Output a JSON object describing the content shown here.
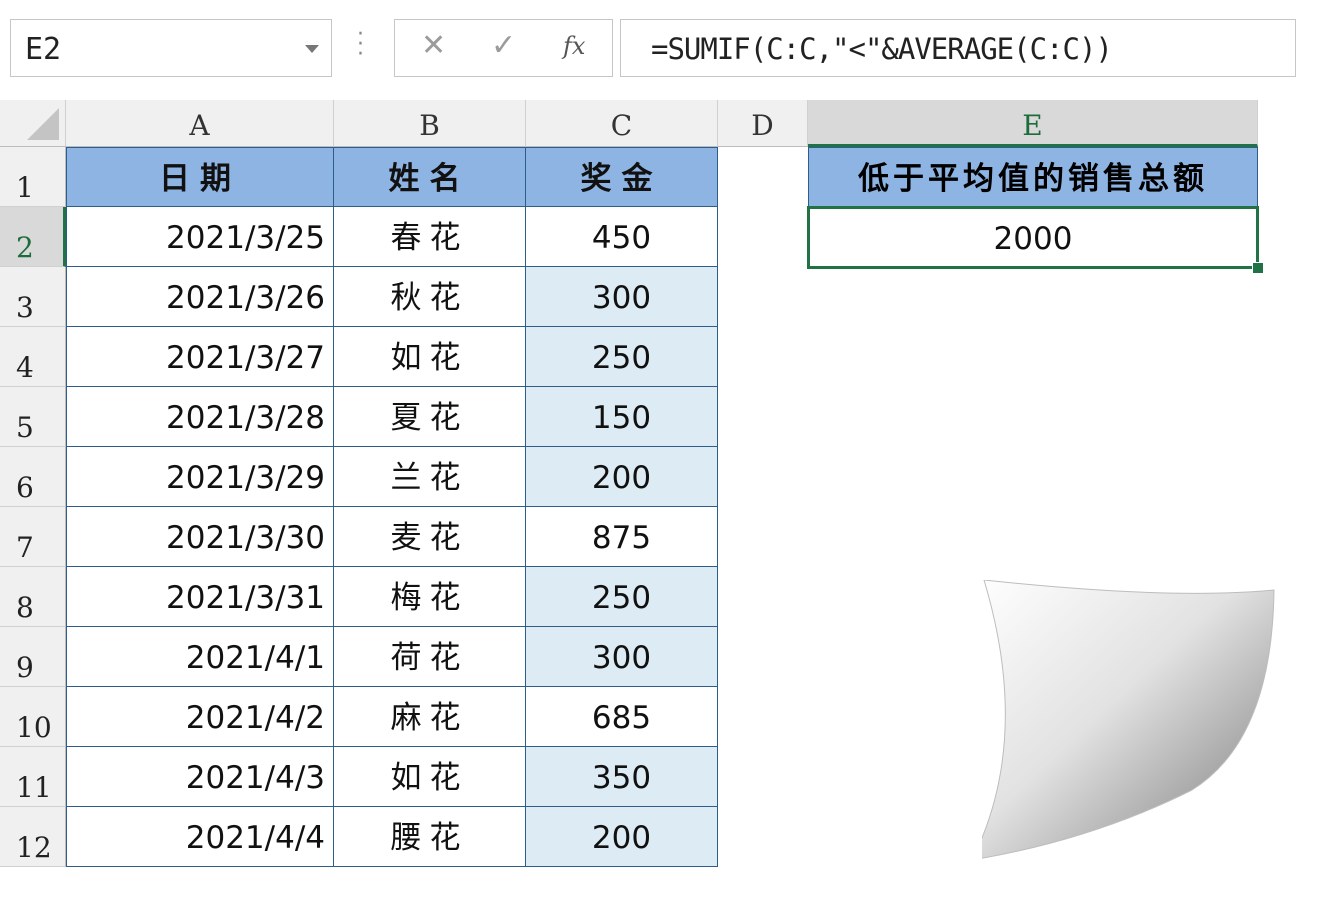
{
  "name_box": {
    "value": "E2"
  },
  "formula_bar": {
    "cancel_icon": "✕",
    "enter_icon": "✓",
    "fx_label": "fx",
    "formula": "=SUMIF(C:C,\"<\"&AVERAGE(C:C))"
  },
  "columns": [
    "A",
    "B",
    "C",
    "D",
    "E"
  ],
  "selected_column": "E",
  "selected_row": "2",
  "table": {
    "headers": [
      "日期",
      "姓名",
      "奖金"
    ],
    "rows": [
      {
        "row": "2",
        "date": "2021/3/25",
        "name": "春花",
        "amount": "450",
        "shaded": false
      },
      {
        "row": "3",
        "date": "2021/3/26",
        "name": "秋花",
        "amount": "300",
        "shaded": true
      },
      {
        "row": "4",
        "date": "2021/3/27",
        "name": "如花",
        "amount": "250",
        "shaded": true
      },
      {
        "row": "5",
        "date": "2021/3/28",
        "name": "夏花",
        "amount": "150",
        "shaded": true
      },
      {
        "row": "6",
        "date": "2021/3/29",
        "name": "兰花",
        "amount": "200",
        "shaded": true
      },
      {
        "row": "7",
        "date": "2021/3/30",
        "name": "麦花",
        "amount": "875",
        "shaded": false
      },
      {
        "row": "8",
        "date": "2021/3/31",
        "name": "梅花",
        "amount": "250",
        "shaded": true
      },
      {
        "row": "9",
        "date": "2021/4/1",
        "name": "荷花",
        "amount": "300",
        "shaded": true
      },
      {
        "row": "10",
        "date": "2021/4/2",
        "name": "麻花",
        "amount": "685",
        "shaded": false
      },
      {
        "row": "11",
        "date": "2021/4/3",
        "name": "如花",
        "amount": "350",
        "shaded": true
      },
      {
        "row": "12",
        "date": "2021/4/4",
        "name": "腰花",
        "amount": "200",
        "shaded": true
      }
    ]
  },
  "result": {
    "header": "低于平均值的销售总额",
    "value": "2000"
  },
  "colors": {
    "header_fill": "#8eb4e3",
    "highlight_fill": "#ddebf4",
    "selection": "#217346"
  }
}
